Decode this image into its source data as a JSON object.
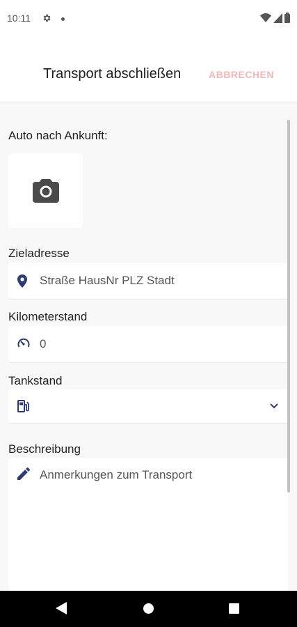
{
  "status_bar": {
    "time": "10:11",
    "icons": [
      "gear-icon",
      "notification-dot-icon",
      "wifi-icon",
      "signal-icon",
      "battery-icon"
    ]
  },
  "header": {
    "title": "Transport abschließen",
    "cancel_label": "ABBRECHEN",
    "cancel_color": "#f4b5b9"
  },
  "form": {
    "photo": {
      "label": "Auto nach Ankunft:",
      "icon": "camera-icon"
    },
    "address": {
      "label": "Zieladresse",
      "placeholder": "Straße HausNr PLZ Stadt",
      "icon": "location-pin-icon"
    },
    "mileage": {
      "label": "Kilometerstand",
      "value": "0",
      "icon": "speedometer-icon"
    },
    "fuel": {
      "label": "Tankstand",
      "value": "",
      "icon": "fuel-pump-icon"
    },
    "description": {
      "label": "Beschreibung",
      "placeholder": "Anmerkungen zum Transport",
      "icon": "pencil-icon"
    }
  },
  "theme": {
    "icon_color": "#2c3a7a",
    "accent": "#f4b5b9"
  },
  "nav": {
    "icons": [
      "back-icon",
      "home-icon",
      "recents-icon"
    ]
  }
}
